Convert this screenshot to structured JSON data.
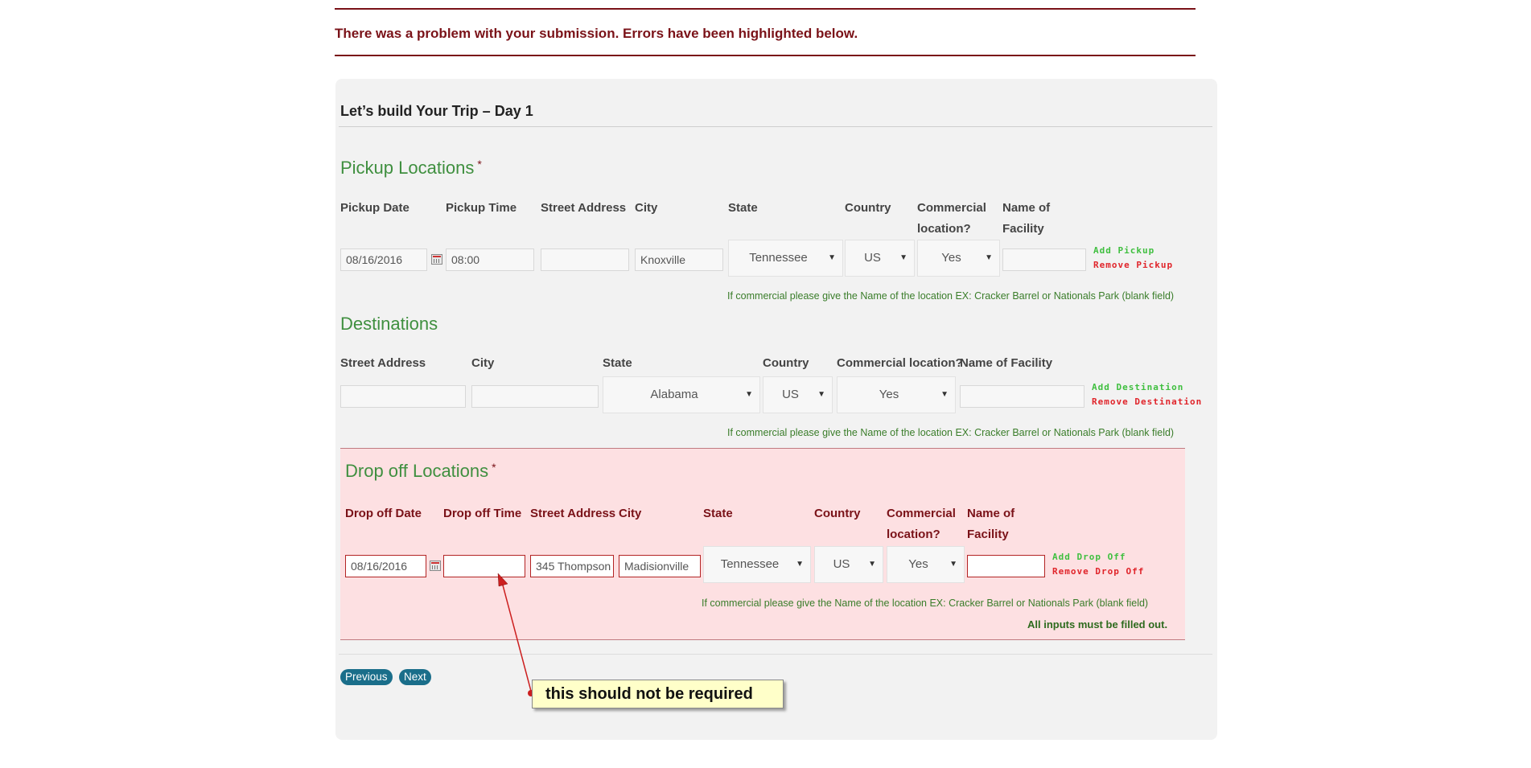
{
  "error_banner": "There was a problem with your submission. Errors have been highlighted below.",
  "card": {
    "title": "Let’s build Your Trip – Day 1"
  },
  "pickup": {
    "title": "Pickup Locations",
    "required_mark": "*",
    "labels": {
      "date": "Pickup Date",
      "time": "Pickup Time",
      "street": "Street Address",
      "city": "City",
      "state": "State",
      "country": "Country",
      "commercial_1": "Commercial",
      "commercial_2": "location?",
      "facility_1": "Name of",
      "facility_2": "Facility"
    },
    "values": {
      "date": "08/16/2016",
      "time": "08:00",
      "street": "",
      "city": "Knoxville",
      "state": "Tennessee",
      "country": "US",
      "commercial": "Yes",
      "facility": ""
    },
    "add": "Add Pickup",
    "remove": "Remove Pickup",
    "hint": "If commercial please give the Name of the location EX: Cracker Barrel or Nationals Park (blank field)"
  },
  "destinations": {
    "title": "Destinations",
    "labels": {
      "street": "Street Address",
      "city": "City",
      "state": "State",
      "country": "Country",
      "commercial": "Commercial location?",
      "facility": "Name of Facility"
    },
    "values": {
      "street": "",
      "city": "",
      "state": "Alabama",
      "country": "US",
      "commercial": "Yes",
      "facility": ""
    },
    "add": "Add Destination",
    "remove": "Remove Destination",
    "hint": "If commercial please give the Name of the location EX: Cracker Barrel or Nationals Park (blank field)"
  },
  "dropoff": {
    "title": "Drop off Locations",
    "required_mark": "*",
    "labels": {
      "date": "Drop off Date",
      "time": "Drop off Time",
      "street": "Street Address",
      "city": "City",
      "state": "State",
      "country": "Country",
      "commercial_1": "Commercial",
      "commercial_2": "location?",
      "facility_1": "Name of",
      "facility_2": "Facility"
    },
    "values": {
      "date": "08/16/2016",
      "time": "",
      "street": "345 Thompson",
      "city": "Madisionville",
      "state": "Tennessee",
      "country": "US",
      "commercial": "Yes",
      "facility": ""
    },
    "add": "Add Drop Off",
    "remove": "Remove Drop Off",
    "hint": "If commercial please give the Name of the location EX: Cracker Barrel or Nationals Park (blank field)",
    "validation": "All inputs must be filled out."
  },
  "nav": {
    "previous": "Previous",
    "next": "Next"
  },
  "annotation": {
    "text": "this should not be required"
  },
  "colors": {
    "error": "#7a1218",
    "section_green": "#3f8f3f",
    "add_green": "#3fbf3f",
    "remove_red": "#e0242a",
    "button": "#1a6e8a"
  }
}
